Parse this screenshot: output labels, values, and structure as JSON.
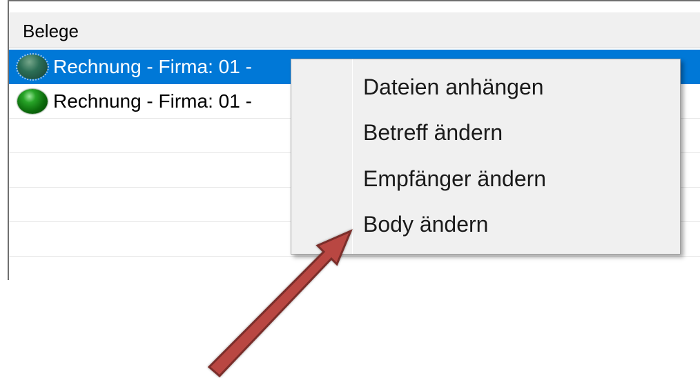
{
  "list": {
    "header": "Belege",
    "rows": [
      {
        "label": "Rechnung - Firma: 01 -",
        "selected": true,
        "icon": "green-status-orb-icon"
      },
      {
        "label": "Rechnung - Firma: 01 -",
        "selected": false,
        "icon": "green-status-orb-icon"
      }
    ]
  },
  "context_menu": {
    "items": [
      {
        "label": "Dateien anhängen"
      },
      {
        "label": "Betreff ändern"
      },
      {
        "label": "Empfänger ändern"
      },
      {
        "label": "Body ändern"
      }
    ]
  },
  "annotation": {
    "icon": "red-arrow-icon",
    "color": "#b94743"
  },
  "colors": {
    "selection": "#0078d7",
    "menu_background": "#f0f0f0",
    "header_background": "#f0f0f0"
  }
}
